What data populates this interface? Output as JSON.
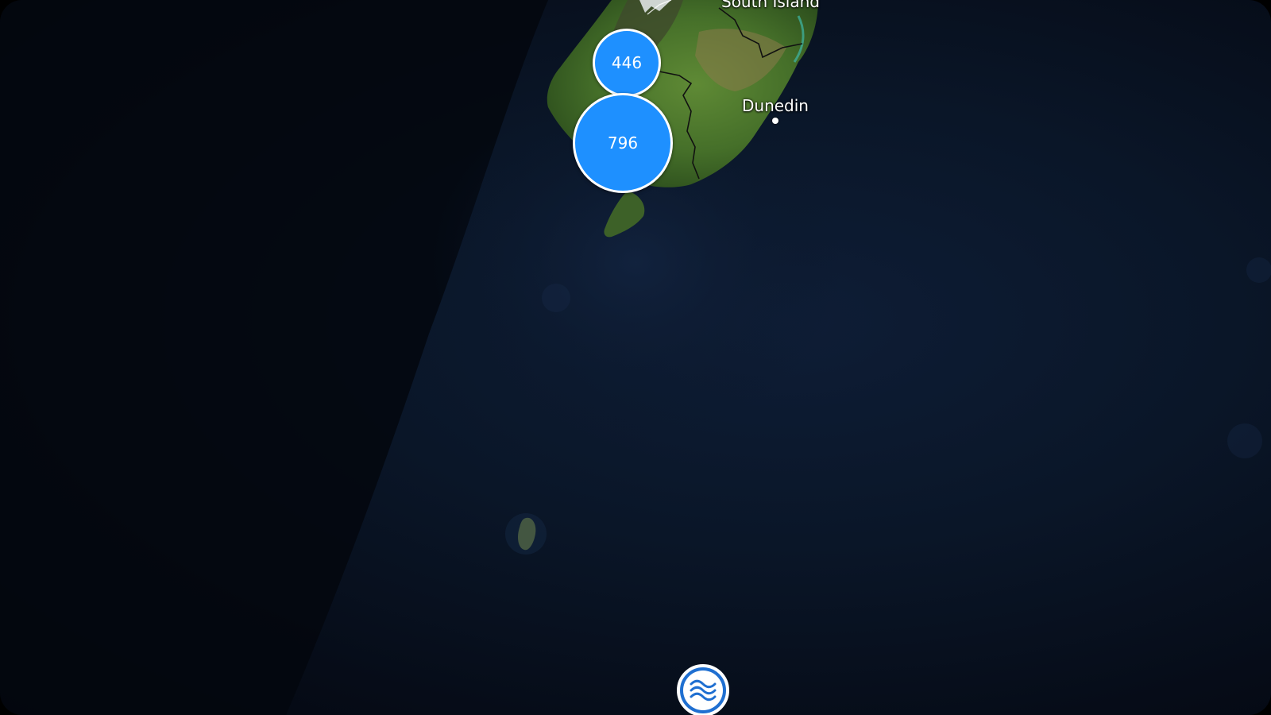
{
  "map": {
    "labels": {
      "region": "South Island",
      "city": "Dunedin"
    },
    "clusters": [
      {
        "count": "446"
      },
      {
        "count": "796"
      }
    ],
    "colors": {
      "cluster_fill": "#1e90ff",
      "cluster_border": "#ffffff",
      "ocean": "#0a1628",
      "land": "#4e7a2c"
    },
    "marker": {
      "icon": "waves-icon"
    }
  }
}
